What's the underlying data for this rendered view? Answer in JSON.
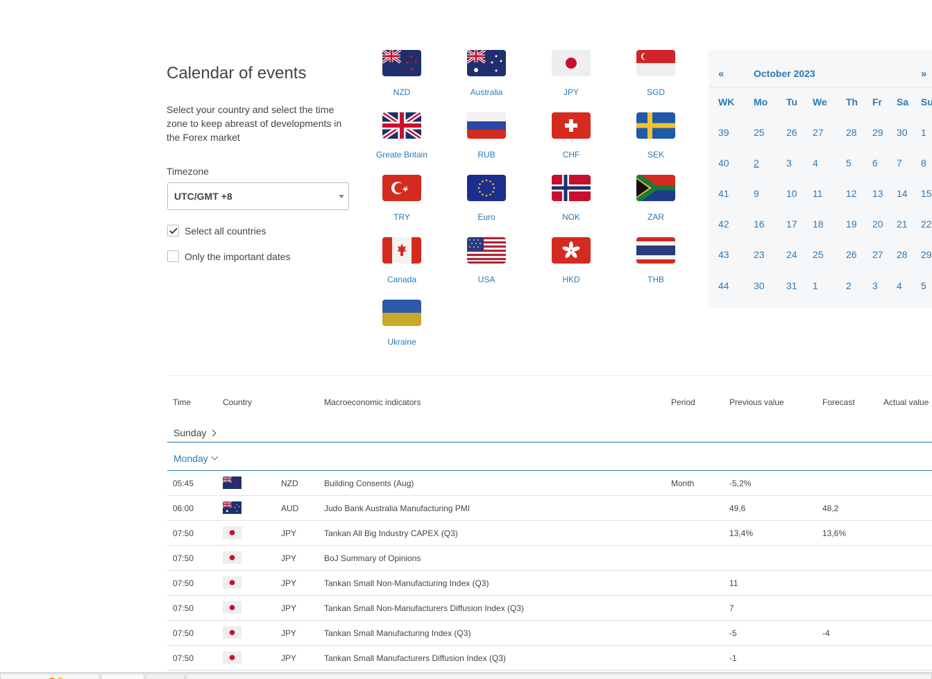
{
  "page": {
    "title": "Calendar of events",
    "intro": "Select your country and select the time zone to keep abreast of developments in the Forex market"
  },
  "timezone": {
    "label": "Timezone",
    "value": "UTC/GMT +8"
  },
  "filters": {
    "select_all": {
      "label": "Select all countries",
      "checked": true
    },
    "important_only": {
      "label": "Only the important dates",
      "checked": false
    }
  },
  "countries": [
    {
      "label": "NZD",
      "icon": "nz-flag-icon"
    },
    {
      "label": "Australia",
      "icon": "au-flag-icon"
    },
    {
      "label": "JPY",
      "icon": "jp-flag-icon"
    },
    {
      "label": "SGD",
      "icon": "sg-flag-icon"
    },
    {
      "label": "Greate Britain",
      "icon": "gb-flag-icon"
    },
    {
      "label": "RUB",
      "icon": "ru-flag-icon"
    },
    {
      "label": "CHF",
      "icon": "ch-flag-icon"
    },
    {
      "label": "SEK",
      "icon": "se-flag-icon"
    },
    {
      "label": "TRY",
      "icon": "tr-flag-icon"
    },
    {
      "label": "Euro",
      "icon": "eu-flag-icon"
    },
    {
      "label": "NOK",
      "icon": "no-flag-icon"
    },
    {
      "label": "ZAR",
      "icon": "za-flag-icon"
    },
    {
      "label": "Canada",
      "icon": "ca-flag-icon"
    },
    {
      "label": "USA",
      "icon": "us-flag-icon"
    },
    {
      "label": "HKD",
      "icon": "hk-flag-icon"
    },
    {
      "label": "THB",
      "icon": "th-flag-icon"
    },
    {
      "label": "Ukraine",
      "icon": "ua-flag-icon"
    }
  ],
  "calendar": {
    "prev": "«",
    "next": "»",
    "month": "October 2023",
    "headers": [
      "WK",
      "Mo",
      "Tu",
      "We",
      "Th",
      "Fr",
      "Sa",
      "Su"
    ],
    "weeks": [
      [
        "39",
        "25",
        "26",
        "27",
        "28",
        "29",
        "30",
        "1"
      ],
      [
        "40",
        "2",
        "3",
        "4",
        "5",
        "6",
        "7",
        "8"
      ],
      [
        "41",
        "9",
        "10",
        "11",
        "12",
        "13",
        "14",
        "15"
      ],
      [
        "42",
        "16",
        "17",
        "18",
        "19",
        "20",
        "21",
        "22"
      ],
      [
        "43",
        "23",
        "24",
        "25",
        "26",
        "27",
        "28",
        "29"
      ],
      [
        "44",
        "30",
        "31",
        "1",
        "2",
        "3",
        "4",
        "5"
      ]
    ],
    "selected_day": "2"
  },
  "events_table": {
    "headers": {
      "time": "Time",
      "country": "Country",
      "indicator": "Macroeconomic indicators",
      "period": "Period",
      "previous": "Previous value",
      "forecast": "Forecast",
      "actual": "Actual value"
    },
    "days": [
      {
        "label": "Sunday",
        "expanded": false
      },
      {
        "label": "Monday",
        "expanded": true
      }
    ],
    "rows": [
      {
        "time": "05:45",
        "flag": "nz-flag-icon",
        "code": "NZD",
        "indicator": "Building Consents (Aug)",
        "period": "Month",
        "previous": "-5,2%",
        "forecast": "",
        "actual": ""
      },
      {
        "time": "06:00",
        "flag": "au-flag-icon",
        "code": "AUD",
        "indicator": "Judo Bank Australia Manufacturing PMI",
        "period": "",
        "previous": "49,6",
        "forecast": "48,2",
        "actual": ""
      },
      {
        "time": "07:50",
        "flag": "jp-flag-icon",
        "code": "JPY",
        "indicator": "Tankan All Big Industry CAPEX (Q3)",
        "period": "",
        "previous": "13,4%",
        "forecast": "13,6%",
        "actual": ""
      },
      {
        "time": "07:50",
        "flag": "jp-flag-icon",
        "code": "JPY",
        "indicator": "BoJ Summary of Opinions",
        "period": "",
        "previous": "",
        "forecast": "",
        "actual": ""
      },
      {
        "time": "07:50",
        "flag": "jp-flag-icon",
        "code": "JPY",
        "indicator": "Tankan Small Non-Manufacturing Index (Q3)",
        "period": "",
        "previous": "11",
        "forecast": "",
        "actual": ""
      },
      {
        "time": "07:50",
        "flag": "jp-flag-icon",
        "code": "JPY",
        "indicator": "Tankan Small Non-Manufacturers Diffusion Index (Q3)",
        "period": "",
        "previous": "7",
        "forecast": "",
        "actual": ""
      },
      {
        "time": "07:50",
        "flag": "jp-flag-icon",
        "code": "JPY",
        "indicator": "Tankan Small Manufacturing Index (Q3)",
        "period": "",
        "previous": "-5",
        "forecast": "-4",
        "actual": ""
      },
      {
        "time": "07:50",
        "flag": "jp-flag-icon",
        "code": "JPY",
        "indicator": "Tankan Small Manufacturers Diffusion Index (Q3)",
        "period": "",
        "previous": "-1",
        "forecast": "",
        "actual": ""
      }
    ]
  },
  "colors": {
    "accent": "#2a7ab5",
    "text": "#444444",
    "calendar_bg": "#f6f7f9"
  }
}
